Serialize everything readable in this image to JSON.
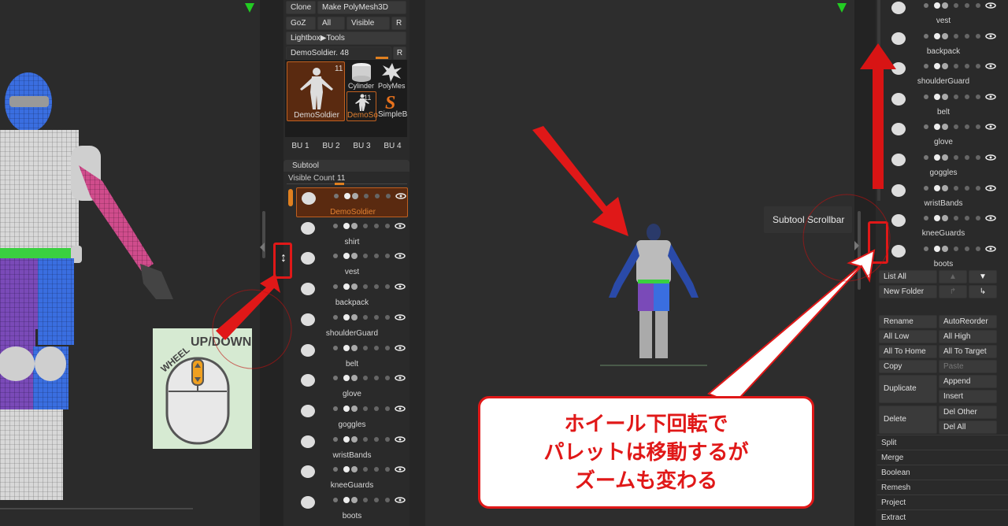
{
  "left_palette": {
    "row1": [
      "Clone",
      "Make PolyMesh3D"
    ],
    "row2": [
      "GoZ",
      "All",
      "Visible",
      "R"
    ],
    "lightbox": "Lightbox▶Tools",
    "tool_slider_label": "DemoSoldier. 48",
    "tool_slider_r": "R",
    "main_thumb_count": "11",
    "main_thumb_label": "DemoSoldier",
    "thumbs": [
      {
        "label": "Cylinder",
        "count": ""
      },
      {
        "label": "PolyMes",
        "count": ""
      },
      {
        "label": "DemoSo",
        "count": "11"
      },
      {
        "label": "SimpleB",
        "count": ""
      }
    ],
    "bu_buttons": [
      "BU 1",
      "BU 2",
      "BU 3",
      "BU 4"
    ],
    "subtool_header": "Subtool",
    "visible_count_label": "Visible Count",
    "visible_count_value": "11",
    "subtools": [
      "DemoSoldier",
      "shirt",
      "vest",
      "backpack",
      "shoulderGuard",
      "belt",
      "glove",
      "goggles",
      "wristBands",
      "kneeGuards",
      "boots"
    ]
  },
  "right_palette": {
    "subtools": [
      "vest",
      "backpack",
      "shoulderGuard",
      "belt",
      "glove",
      "goggles",
      "wristBands",
      "kneeGuards",
      "boots"
    ],
    "list_all": "List All",
    "new_folder": "New Folder",
    "buttons": {
      "rename": "Rename",
      "auto_reorder": "AutoReorder",
      "all_low": "All Low",
      "all_high": "All High",
      "all_to_home": "All To Home",
      "all_to_target": "All To Target",
      "copy": "Copy",
      "paste": "Paste",
      "duplicate": "Duplicate",
      "append": "Append",
      "insert": "Insert",
      "delete": "Delete",
      "del_other": "Del Other",
      "del_all": "Del All"
    },
    "menu": [
      "Split",
      "Merge",
      "Boolean",
      "Remesh",
      "Project",
      "Extract"
    ]
  },
  "tooltip": "Subtool Scrollbar",
  "wheel_card": {
    "wheel_text": "WHEEL",
    "updown_text": "UP/DOWN"
  },
  "callout": {
    "line1": "ホイール下回転で",
    "line2": "パレットは移動するが",
    "line3": "ズームも変わる"
  },
  "colors": {
    "accent_red": "#e01818",
    "selection_orange": "#c06020",
    "panel_bg": "#2a2a2a"
  }
}
